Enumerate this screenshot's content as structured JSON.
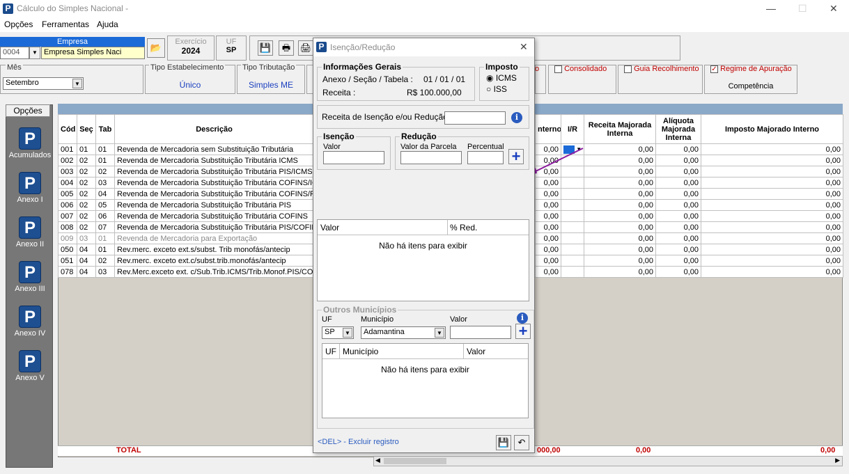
{
  "window": {
    "title": "Cálculo do Simples Nacional -"
  },
  "menu": [
    "Opções",
    "Ferramentas",
    "Ajuda"
  ],
  "empresa": {
    "label": "Empresa",
    "code": "0004",
    "name": "Empresa Simples Naci"
  },
  "exercicio": {
    "label": "Exercício",
    "value": "2024"
  },
  "uf": {
    "label": "UF",
    "value": "SP"
  },
  "mes": {
    "label": "Mês",
    "value": "Setembro"
  },
  "tipo_estabelecimento": {
    "label": "Tipo Estabelecimento",
    "value": "Único"
  },
  "tipo_tributacao": {
    "label": "Tipo Tributação",
    "value": "Simples ME"
  },
  "checks": {
    "consolidado": "Consolidado",
    "guia": "Guia Recolhimento",
    "regime": "Regime de Apuração",
    "regime_value": "Competência",
    "partial_o": "o"
  },
  "sidebar": {
    "header": "Opções",
    "items": [
      "Acumulados",
      "Anexo I",
      "Anexo II",
      "Anexo III",
      "Anexo IV",
      "Anexo V"
    ]
  },
  "grid": {
    "headers": {
      "cod": "Cód",
      "sec": "Seç",
      "tab": "Tab",
      "desc": "Descrição",
      "interno": "nterno",
      "ir": "I/R",
      "receita": "Receita Majorada Interna",
      "aliquota": "Alíquota Majorada Interna",
      "imposto": "Imposto Majorado Interno"
    },
    "rows": [
      [
        "001",
        "01",
        "01",
        "Revenda de Mercadoria sem Substituição Tributária"
      ],
      [
        "002",
        "02",
        "01",
        "Revenda de Mercadoria  Substituição Tributária ICMS"
      ],
      [
        "003",
        "02",
        "02",
        "Revenda de Mercadoria  Substituição Tributária PIS/ICMS"
      ],
      [
        "004",
        "02",
        "03",
        "Revenda de Mercadoria  Substituição Tributária COFINS/IC"
      ],
      [
        "005",
        "02",
        "04",
        "Revenda de Mercadoria  Substituição Tributária COFINS/PI"
      ],
      [
        "006",
        "02",
        "05",
        "Revenda de Mercadoria  Substituição Tributária PIS"
      ],
      [
        "007",
        "02",
        "06",
        "Revenda de Mercadoria  Substituição Tributária COFINS"
      ],
      [
        "008",
        "02",
        "07",
        "Revenda de Mercadoria  Substituição Tributária PIS/COFIN"
      ],
      [
        "009",
        "03",
        "01",
        "Revenda de Mercadoria para Exportação"
      ],
      [
        "050",
        "04",
        "01",
        "Rev.merc. exceto ext.s/subst. Trib monofás/antecip"
      ],
      [
        "051",
        "04",
        "02",
        "Rev.merc. exceto ext.c/subst.trib.monofás/antecip"
      ],
      [
        "078",
        "04",
        "03",
        "Rev.Merc.exceto ext. c/Sub.Trib.ICMS/Trib.Monof.PIS/CO"
      ]
    ],
    "zero": "0,00",
    "total_label": "TOTAL",
    "total_interno": "000,00",
    "total_left": "000,00"
  },
  "dialog": {
    "title": "Isenção/Redução",
    "info_legend": "Informações Gerais",
    "anexo_label": "Anexo / Seção / Tabela :",
    "anexo_value": "01 / 01 / 01",
    "receita_label": "Receita :",
    "receita_value": "R$ 100.000,00",
    "imposto_legend": "Imposto",
    "icms": "ICMS",
    "iss": "ISS",
    "receita_isencao_label": "Receita de Isenção e/ou Redução :",
    "isencao_legend": "Isenção",
    "valor_label": "Valor",
    "reducao_legend": "Redução",
    "valor_parcela": "Valor da Parcela",
    "percentual": "Percentual",
    "list1_col1": "Valor",
    "list1_col2": "% Red.",
    "empty": "Não há itens para exibir",
    "outros_legend": "Outros Municípios",
    "uf_label": "UF",
    "uf_value": "SP",
    "municipio_label": "Município",
    "municipio_value": "Adamantina",
    "list2_uf": "UF",
    "list2_municipio": "Município",
    "list2_valor": "Valor",
    "del_hint": "<DEL> - Excluir registro"
  }
}
